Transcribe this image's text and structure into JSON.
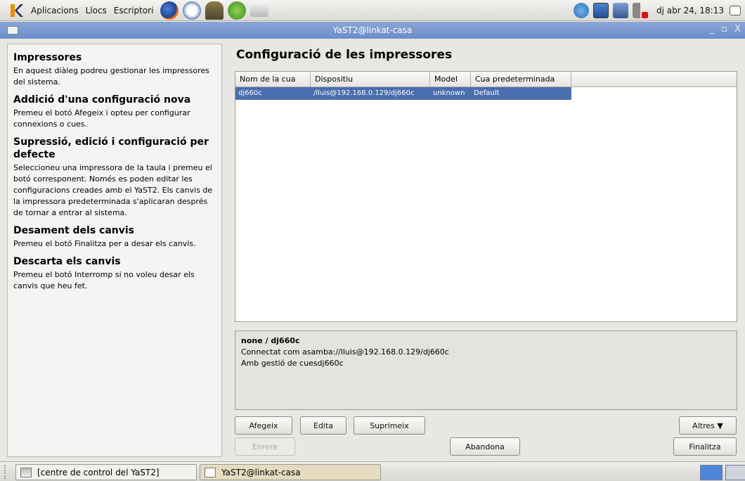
{
  "top_panel": {
    "menus": [
      "Aplicacions",
      "Llocs",
      "Escriptori"
    ],
    "clock": "dj abr 24, 18:13"
  },
  "window": {
    "title": "YaST2@linkat-casa",
    "controls": [
      "_",
      "▫",
      "X"
    ]
  },
  "help": {
    "sections": [
      {
        "title": "Impressores",
        "text": "En aquest diàleg podreu gestionar les impressores del sistema."
      },
      {
        "title": "Addició d'una configuració nova",
        "text": "Premeu el botó Afegeix i opteu per configurar connexions o cues."
      },
      {
        "title": "Supressió, edició i configuració per defecte",
        "text": "Seleccioneu una impressora de la taula i premeu el botó corresponent. Només es poden editar les configuracions creades amb el YaST2. Els canvis de la impressora predeterminada s'aplicaran després de tornar a entrar al sistema."
      },
      {
        "title": "Desament dels canvis",
        "text": "Premeu el botó Finalitza per a desar els canvis."
      },
      {
        "title": "Descarta els canvis",
        "text": "Premeu el botó Interromp si no voleu desar els canvis que heu fet."
      }
    ]
  },
  "main": {
    "title": "Configuració de les impressores",
    "columns": [
      "Nom de la cua",
      "Dispositiu",
      "Model",
      "Cua predeterminada"
    ],
    "rows": [
      {
        "queue": "dj660c",
        "device": "/lluis@192.168.0.129/dj660c",
        "model": "unknown",
        "default": "Default"
      }
    ],
    "info": {
      "title": "none / dj660c",
      "line1": "Connectat com asamba://lluis@192.168.0.129/dj660c",
      "line2": "Amb gestió de cuesdj660c"
    }
  },
  "buttons": {
    "add": "Afegeix",
    "edit": "Edita",
    "delete": "Suprimeix",
    "other": "Altres ▼",
    "back": "Enrere",
    "abort": "Abandona",
    "finish": "Finalitza"
  },
  "taskbar": {
    "task1": "[centre de control del YaST2]",
    "task2": "YaST2@linkat-casa"
  }
}
